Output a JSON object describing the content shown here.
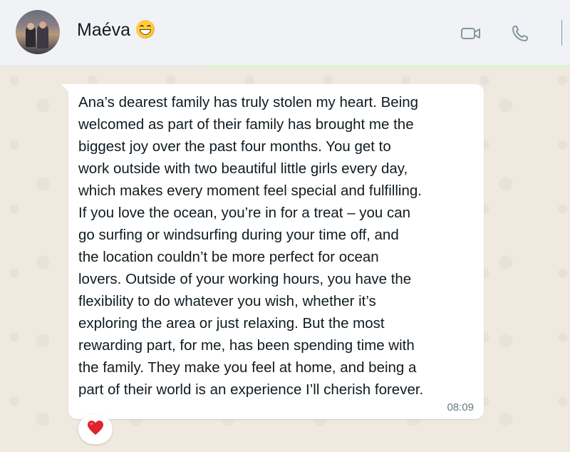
{
  "chat_header": {
    "contact_name": "Maéva",
    "name_emoji_icon": "grinning-face-with-smiling-eyes-icon",
    "actions": [
      "video-call-icon",
      "voice-call-icon"
    ]
  },
  "message": {
    "lines": [
      "Ana’s dearest family has truly stolen my heart. Being",
      "welcomed as part of their family has brought me the",
      "biggest joy over the past four months. You get to",
      "work outside with two beautiful little girls every day,",
      "which makes every moment feel special and fulfilling.",
      "If you love the ocean, you’re in for a treat – you can",
      "go surfing or windsurfing during your time off, and",
      "the location couldn’t be more perfect for ocean",
      "lovers. Outside of your working hours, you have the",
      "flexibility to do whatever you wish, whether it’s",
      "exploring the area or just relaxing. But the most",
      "rewarding part, for me, has been spending time with",
      "the family. They make you feel at home, and being a",
      "part of their world is an experience I’ll cherish forever."
    ],
    "time": "08:09",
    "reaction_icon": "red-heart-icon"
  },
  "colors": {
    "header_bg": "#f0f2f5",
    "bubble_bg": "#ffffff",
    "wallpaper": "#efe9e0",
    "text": "#111b21",
    "meta_text": "#667781",
    "heart": "#e0242e"
  }
}
